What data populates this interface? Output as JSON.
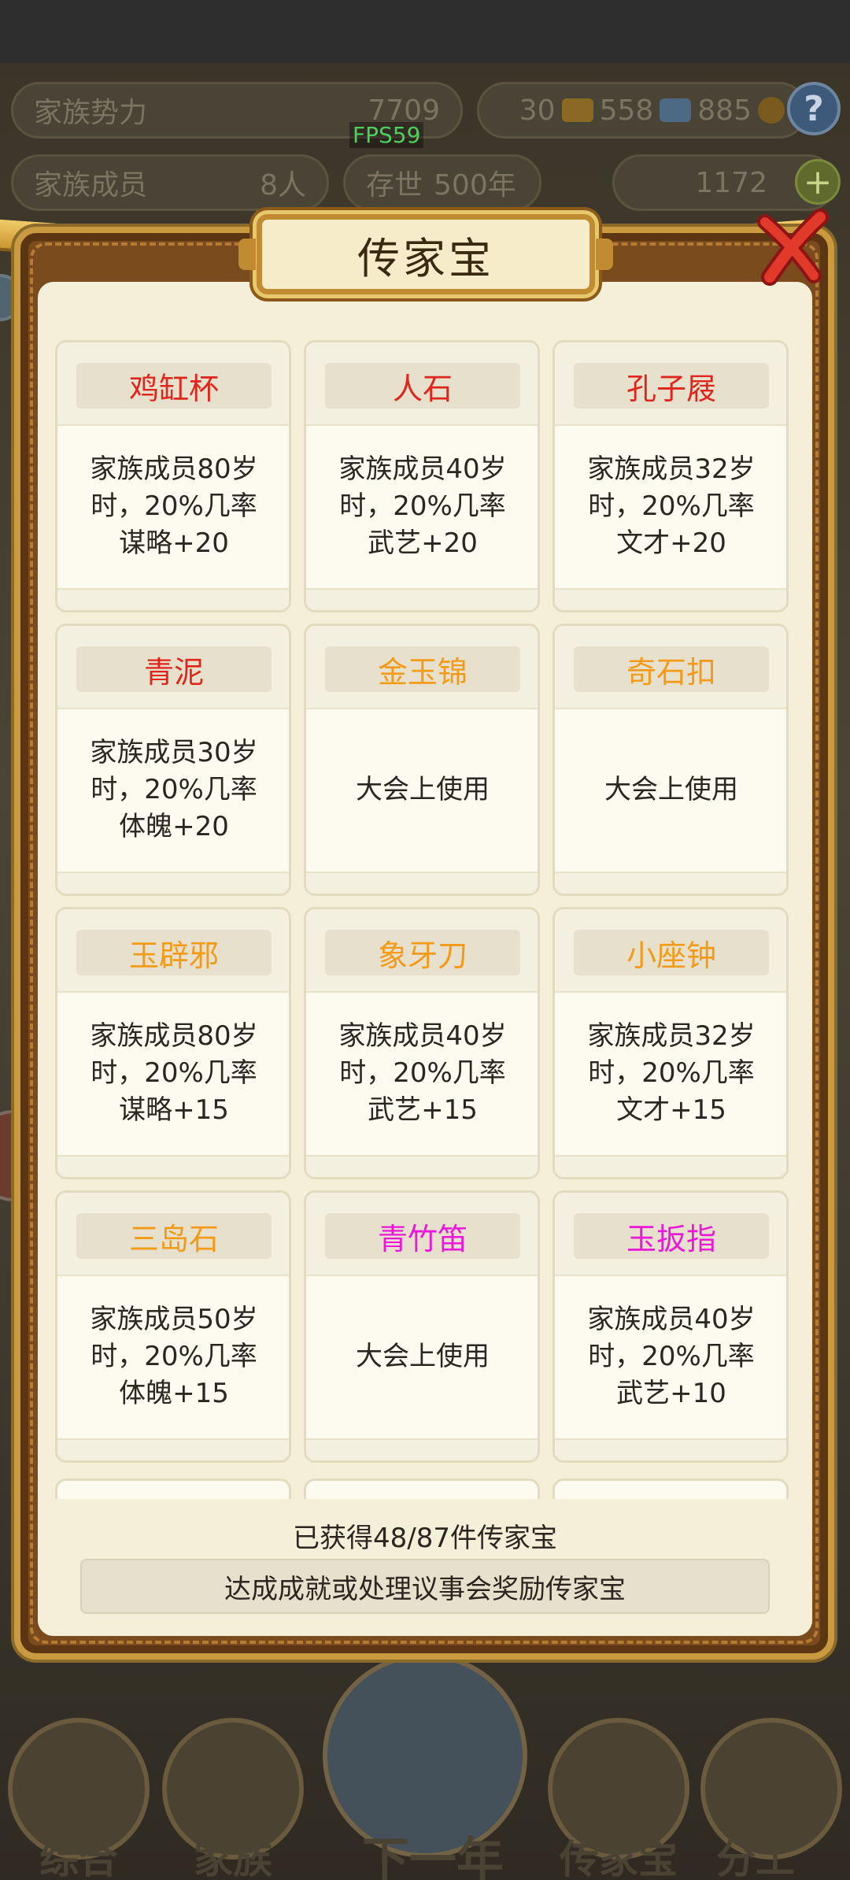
{
  "hud": {
    "power_label": "家族势力",
    "power_value": "7709",
    "members_label": "家族成员",
    "members_value": "8人",
    "age_label": "存世",
    "age_value": "500年",
    "gold_bars": "30",
    "silver_bars": "558",
    "coins": "885",
    "ingots": "1172",
    "fps": "FPS59"
  },
  "modal": {
    "title": "传家宝",
    "items": [
      {
        "name": "鸡缸杯",
        "color": "red",
        "desc": "家族成员80岁\n时，20%几率\n谋略+20"
      },
      {
        "name": "人石",
        "color": "red",
        "desc": "家族成员40岁\n时，20%几率\n武艺+20"
      },
      {
        "name": "孔子屐",
        "color": "red",
        "desc": "家族成员32岁\n时，20%几率\n文才+20"
      },
      {
        "name": "青泥",
        "color": "red",
        "desc": "家族成员30岁\n时，20%几率\n体魄+20"
      },
      {
        "name": "金玉锦",
        "color": "orange",
        "desc": "大会上使用"
      },
      {
        "name": "奇石扣",
        "color": "orange",
        "desc": "大会上使用"
      },
      {
        "name": "玉辟邪",
        "color": "orange",
        "desc": "家族成员80岁\n时，20%几率\n谋略+15"
      },
      {
        "name": "象牙刀",
        "color": "orange",
        "desc": "家族成员40岁\n时，20%几率\n武艺+15"
      },
      {
        "name": "小座钟",
        "color": "orange",
        "desc": "家族成员32岁\n时，20%几率\n文才+15"
      },
      {
        "name": "三岛石",
        "color": "orange",
        "desc": "家族成员50岁\n时，20%几率\n体魄+15"
      },
      {
        "name": "青竹笛",
        "color": "magenta",
        "desc": "大会上使用"
      },
      {
        "name": "玉扳指",
        "color": "magenta",
        "desc": "家族成员40岁\n时，20%几率\n武艺+10"
      }
    ],
    "count_text": "已获得48/87件传家宝",
    "hint_text": "达成成就或处理议事会奖励传家宝"
  },
  "nav": {
    "items": [
      "综合",
      "家族",
      "下一年",
      "传家宝",
      "分工"
    ]
  },
  "colors": {
    "red": "#e0261c",
    "orange": "#f39b18",
    "magenta": "#ea18d9",
    "frame_gold": "#c99a3f",
    "panel_cream": "#f5efd9"
  }
}
